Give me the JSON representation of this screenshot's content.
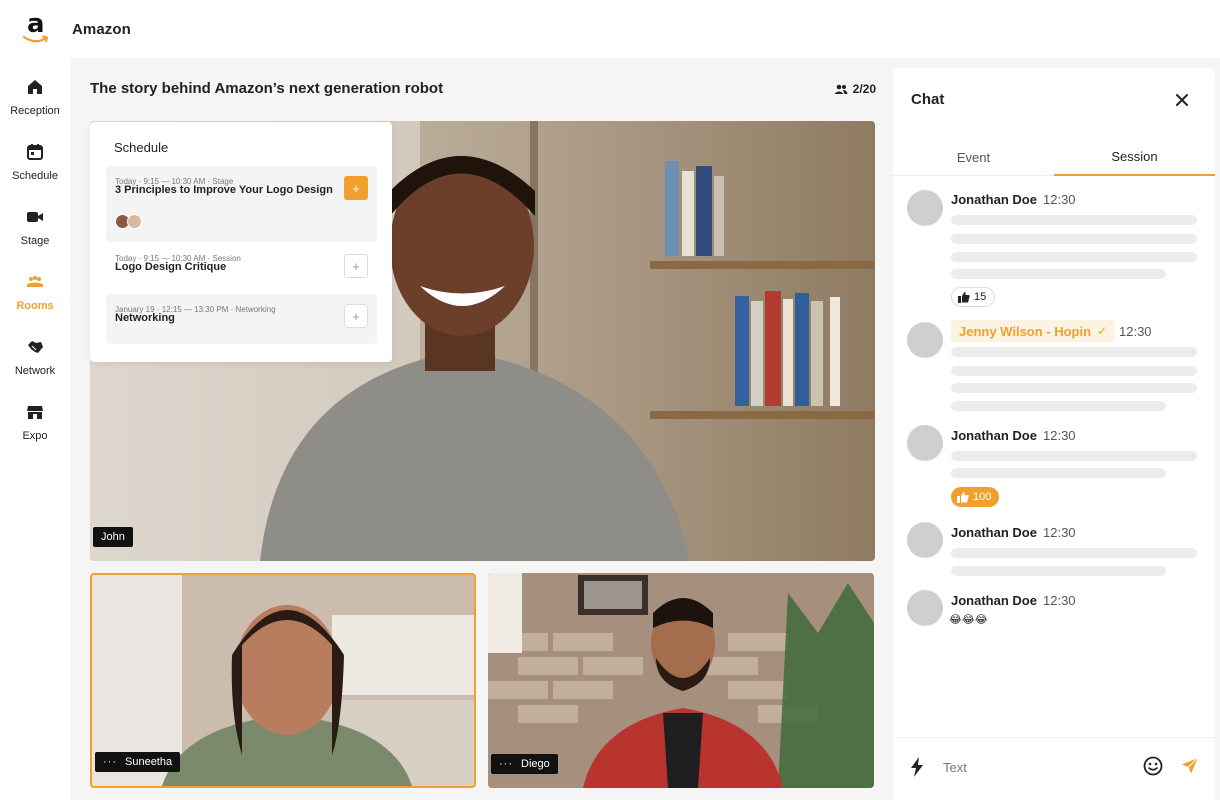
{
  "app": {
    "title": "Amazon"
  },
  "nav": {
    "items": [
      {
        "label": "Reception",
        "icon": "home-icon"
      },
      {
        "label": "Schedule",
        "icon": "calendar-icon"
      },
      {
        "label": "Stage",
        "icon": "video-camera-icon"
      },
      {
        "label": "Rooms",
        "icon": "rooms-icon",
        "active": true
      },
      {
        "label": "Network",
        "icon": "handshake-icon"
      },
      {
        "label": "Expo",
        "icon": "storefront-icon"
      }
    ]
  },
  "session": {
    "title": "The story behind Amazon’s next generation robot",
    "attendees": "2/20",
    "attendees_icon": "people-icon"
  },
  "videos": {
    "main": {
      "name": "John"
    },
    "tiles": [
      {
        "name": "Suneetha",
        "active": true
      },
      {
        "name": "Diego"
      }
    ]
  },
  "schedule": {
    "title": "Schedule",
    "items": [
      {
        "meta": "Today · 9:15 — 10:30 AM · Stage",
        "name": "3 Principles to Improve Your Logo Design",
        "action": "+"
      },
      {
        "meta": "Today · 9:15 — 10:30 AM · Session",
        "name": "Logo Design Critique",
        "action": "+"
      },
      {
        "meta": "January 19 · 12:15 — 13:30 PM · Networking",
        "name": "Networking",
        "action": "+"
      }
    ]
  },
  "chat": {
    "title": "Chat",
    "tabs": [
      {
        "label": "Event"
      },
      {
        "label": "Session",
        "active": true
      }
    ],
    "messages": [
      {
        "name": "Jonathan Doe",
        "time": "12:30",
        "reaction": {
          "icon": "thumbs-up-icon",
          "count": "15"
        }
      },
      {
        "name": "Jenny Wilson - Hopin",
        "check": "✓",
        "time": "12:30",
        "highlighted": true
      },
      {
        "name": "Jonathan Doe",
        "time": "12:30",
        "reaction": {
          "icon": "thumbs-up-icon",
          "count": "100"
        }
      },
      {
        "name": "Jonathan Doe",
        "time": "12:30"
      },
      {
        "name": "Jonathan Doe",
        "time": "12:30",
        "text": "😂😂😂"
      }
    ],
    "input_placeholder": "Text"
  },
  "colors": {
    "accent": "#f0a02c",
    "background": "#f5f5f5",
    "skeleton": "#ececec"
  }
}
